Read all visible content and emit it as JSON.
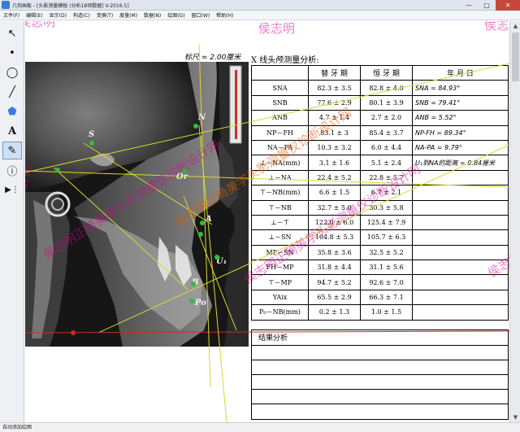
{
  "window": {
    "title": "几何画板 - [头影测量模板 (分析18项数据] V-2016.5]",
    "minimize_label": "—",
    "maximize_label": "□",
    "close_label": "✕"
  },
  "menu": [
    "文件(F)",
    "编辑(E)",
    "显示(D)",
    "构造(C)",
    "变换(T)",
    "度量(M)",
    "数据(N)",
    "绘图(G)",
    "窗口(W)",
    "帮助(H)"
  ],
  "toolbar": {
    "tools": [
      {
        "icon": "arrow-select-icon",
        "glyph": "↖",
        "active": false
      },
      {
        "icon": "point-icon",
        "glyph": "•",
        "active": false
      },
      {
        "icon": "compass-icon",
        "glyph": "◯",
        "active": false
      },
      {
        "icon": "line-icon",
        "glyph": "╱",
        "active": false
      },
      {
        "icon": "polygon-icon",
        "glyph": "⬟",
        "active": false
      },
      {
        "icon": "text-icon",
        "glyph": "A",
        "active": false
      },
      {
        "icon": "marker-icon",
        "glyph": "✎",
        "active": true
      },
      {
        "icon": "info-icon",
        "glyph": "ⓘ",
        "active": false
      },
      {
        "icon": "custom-tool-icon",
        "glyph": "▶⋮",
        "active": false
      }
    ]
  },
  "canvas": {
    "scale_label": "标尺 = 2.00厘米",
    "table_title": "X 线头颅测量分析:",
    "headers": [
      "",
      "替 牙 期",
      "恒 牙 期",
      "年 月 日"
    ],
    "rows": [
      {
        "name": "SNA",
        "mixed": "82.3 ± 3.5",
        "perm": "82.8 ± 4.0",
        "meas": "SNA = 84.93°"
      },
      {
        "name": "SNB",
        "mixed": "77.6 ± 2.9",
        "perm": "80.1 ± 3.9",
        "meas": "SNB = 79.41°"
      },
      {
        "name": "ANB",
        "mixed": "4.7 ± 1.4",
        "perm": "2.7 ± 2.0",
        "meas": "ANB = 5.52°"
      },
      {
        "name": "NP－FH",
        "mixed": "83.1 ± 3",
        "perm": "85.4 ± 3.7",
        "meas": "NP-FH = 89.34°"
      },
      {
        "name": "NA－PA",
        "mixed": "10.3 ± 3.2",
        "perm": "6.0 ± 4.4",
        "meas": "NA-PA = 9.79°"
      },
      {
        "name": "⊥－NA(mm)",
        "mixed": "3.1 ± 1.6",
        "perm": "5.1 ± 2.4",
        "meas": "U₁到NA的距离 = 0.84厘米"
      },
      {
        "name": "⊥－NA",
        "mixed": "22.4 ± 5.2",
        "perm": "22.8 ± 5.7",
        "meas": ""
      },
      {
        "name": "⊤－NB(mm)",
        "mixed": "6.6 ± 1.5",
        "perm": "6.7 ± 2.1",
        "meas": ""
      },
      {
        "name": "⊤－NB",
        "mixed": "32.7 ± 5.0",
        "perm": "30.3 ± 5.8",
        "meas": ""
      },
      {
        "name": "⊥－⊤",
        "mixed": "122.0 ± 6.0",
        "perm": "125.4 ± 7.9",
        "meas": ""
      },
      {
        "name": "⊥－SN",
        "mixed": "104.8 ± 5.3",
        "perm": "105.7 ± 6.3",
        "meas": ""
      },
      {
        "name": "MP－SN",
        "mixed": "35.8 ± 3.6",
        "perm": "32.5 ± 5.2",
        "meas": ""
      },
      {
        "name": "FH－MP",
        "mixed": "31.8 ± 4.4",
        "perm": "31.1 ± 5.6",
        "meas": ""
      },
      {
        "name": "⊤－MP",
        "mixed": "94.7 ± 5.2",
        "perm": "92.6 ± 7.0",
        "meas": ""
      },
      {
        "name": "YAix",
        "mixed": "65.5 ± 2.9",
        "perm": "66.3 ± 7.1",
        "meas": ""
      },
      {
        "name": "P₀－NB(mm)",
        "mixed": "0.2 ± 1.3",
        "perm": "1.0 ± 1.5",
        "meas": ""
      }
    ],
    "summary_label": "结果分析",
    "landmarks": {
      "S": "S",
      "N": "N",
      "Or": "Or",
      "A": "A",
      "U1": "U₁",
      "B": "B",
      "Po": "Po"
    },
    "watermarks": [
      "侯志明正畸美学头影测量仪诊断设计网",
      "侯志明正畸美学头影测量仪诊断设计网",
      "侯志明正畸美学头影测量仪诊断设计网",
      "侯志明正",
      "侯志明",
      "侯志明",
      "侯志明",
      "侯志明",
      "计网"
    ]
  },
  "status": {
    "text": "自动添加绘图"
  },
  "colors": {
    "line_yellow": "#d8d832",
    "line_red": "#c0302a",
    "point_green": "#2fbf3a",
    "watermark": "#dc0096"
  }
}
